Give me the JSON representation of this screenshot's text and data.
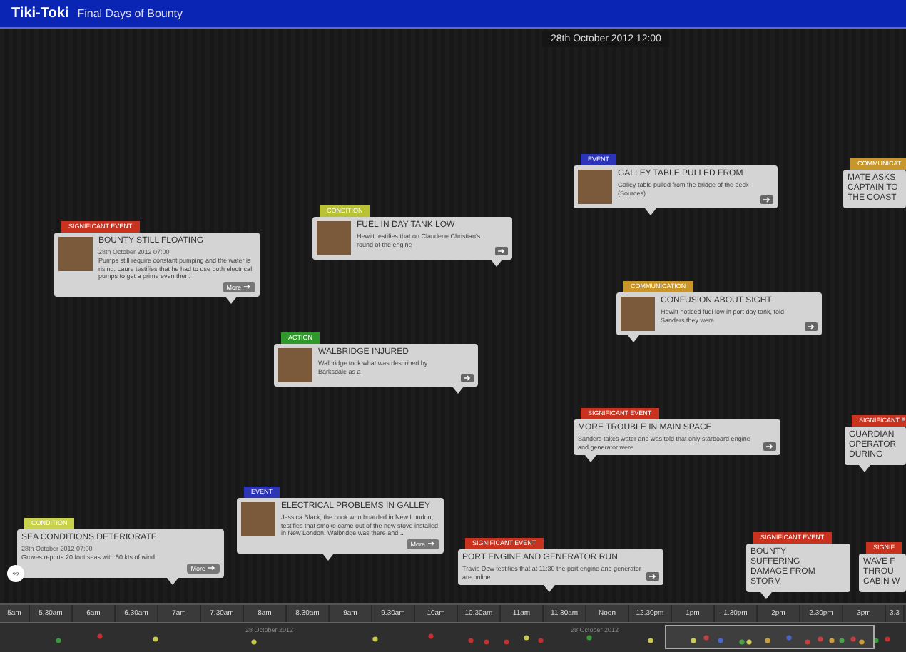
{
  "header": {
    "logo": "Tiki-Toki",
    "title": "Final Days of Bounty"
  },
  "current_date": "28th October 2012 12:00",
  "stories": [
    {
      "category": {
        "label": "SIGNIFICANT EVENT",
        "color": "#c8321e"
      },
      "title": "BOUNTY STILL FLOATING",
      "date": "28th October 2012 07:00",
      "text": "Pumps still require constant pumping and the water is rising. Laure testifies that he had to use both electrical pumps to get a prime even then.",
      "image": true,
      "arrow": false,
      "more": "More"
    },
    {
      "category": {
        "label": "CONDITION",
        "color": "#b8c234"
      },
      "title": "FUEL IN DAY TANK LOW",
      "text": "Hewitt testifies that on Claudene Christian's round of the engine",
      "image": true,
      "arrow": true
    },
    {
      "category": {
        "label": "ACTION",
        "color": "#2f9a2a"
      },
      "title": "WALBRIDGE INJURED",
      "text": "Walbridge took what was described by Barksdale as a",
      "image": true,
      "arrow": true
    },
    {
      "category": {
        "label": "EVENT",
        "color": "#2c34b8"
      },
      "title": "GALLEY TABLE PULLED FROM",
      "text": "Galley table pulled from the bridge of the deck (Sources)",
      "image": true,
      "arrow": true
    },
    {
      "category": {
        "label": "COMMUNICAT",
        "color": "#c8962a"
      },
      "title": "MATE ASKS\nCAPTAIN TO\nTHE COAST",
      "image": false,
      "arrow": false
    },
    {
      "category": {
        "label": "COMMUNICATION",
        "color": "#c8962a"
      },
      "title": "CONFUSION ABOUT SIGHT",
      "text": "Hewitt noticed fuel low in port day tank, told Sanders they were",
      "image": true,
      "arrow": true
    },
    {
      "category": {
        "label": "SIGNIFICANT EVENT",
        "color": "#c8321e"
      },
      "title": "MORE TROUBLE IN MAIN SPACE",
      "text": "Sanders takes water and was told that only starboard engine and generator were",
      "image": false,
      "arrow": true
    },
    {
      "category": {
        "label": "SIGNIFICANT E",
        "color": "#c8321e"
      },
      "title": "GUARDIAN\nOPERATOR\nDURING",
      "image": false,
      "arrow": false
    },
    {
      "category": {
        "label": "CONDITION",
        "color": "#c8d24a"
      },
      "title": "SEA CONDITIONS DETERIORATE",
      "date": "28th October 2012 07:00",
      "text": "Groves reports 20 foot seas with 50 kts of wind.",
      "image": false,
      "arrow": false,
      "more": "More"
    },
    {
      "category": {
        "label": "EVENT",
        "color": "#2c34b8"
      },
      "title": "ELECTRICAL PROBLEMS IN GALLEY",
      "text": "Jessica Black, the cook who boarded in New London, testifies that smoke came out of the new stove installed in New London. Walbridge was there and...",
      "image": true,
      "arrow": false,
      "more": "More"
    },
    {
      "category": {
        "label": "SIGNIFICANT EVENT",
        "color": "#c8321e"
      },
      "title": "PORT ENGINE AND GENERATOR RUN",
      "text": "Travis Dow testifies that at 11:30 the port engine and generator are online",
      "image": false,
      "arrow": true
    },
    {
      "category": {
        "label": "SIGNIFICANT EVENT",
        "color": "#c8321e"
      },
      "title": "BOUNTY\nSUFFERING\nDAMAGE FROM\nSTORM",
      "image": false,
      "arrow": false
    },
    {
      "category": {
        "label": "SIGNIF",
        "color": "#c8321e"
      },
      "title": "WAVE F\nTHROU\nCABIN W",
      "image": false,
      "arrow": false
    }
  ],
  "zoom_button": "??",
  "ticks": [
    "5am",
    "5.30am",
    "6am",
    "6.30am",
    "7am",
    "7.30am",
    "8am",
    "8.30am",
    "9am",
    "9.30am",
    "10am",
    "10.30am",
    "11am",
    "11.30am",
    "Noon",
    "12.30pm",
    "1pm",
    "1.30pm",
    "2pm",
    "2.30pm",
    "3pm",
    "3.3"
  ],
  "map_labels": [
    "28 October 2012",
    "28 October 2012"
  ]
}
